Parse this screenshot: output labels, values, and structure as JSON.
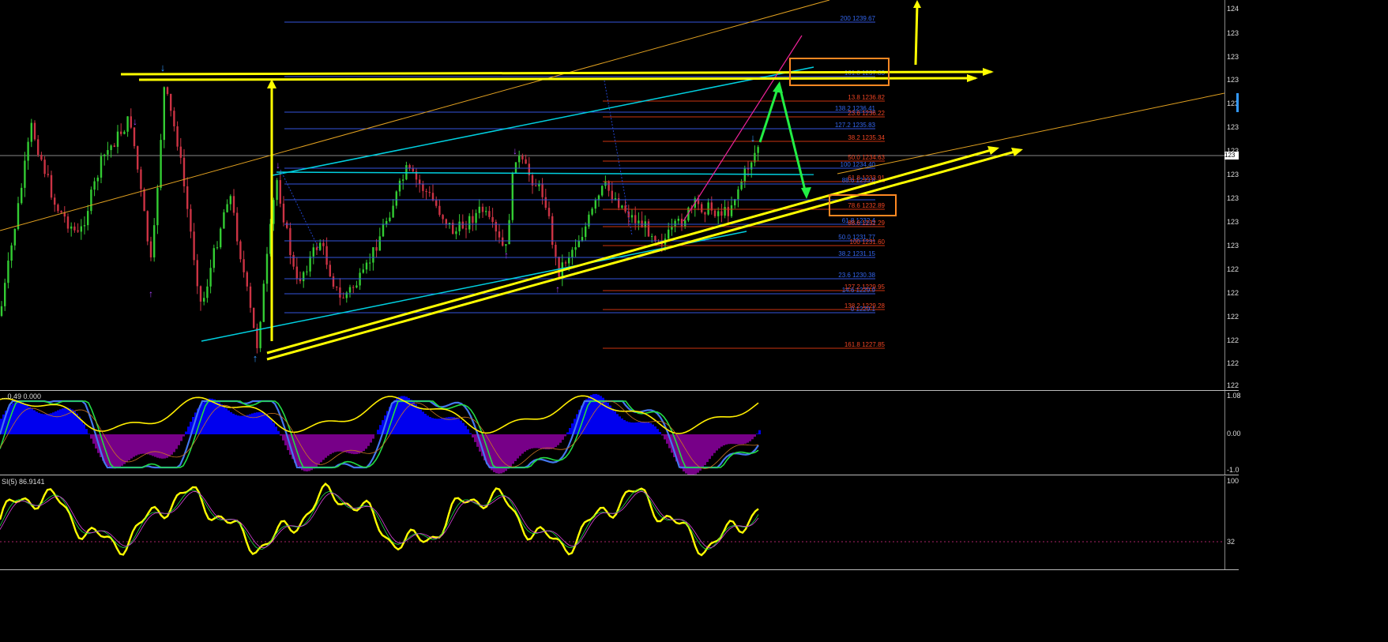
{
  "main_chart": {
    "top_right_ticks": [
      "124",
      "123",
      "123",
      "123",
      "123",
      "123",
      "123",
      "123",
      "123",
      "123",
      "123",
      "122",
      "122",
      "122",
      "122",
      "122",
      "122"
    ],
    "current_price_tag": "123",
    "fib_levels_blue": [
      {
        "label": "200 1239.67"
      },
      {
        "label": "161.8 1237.83"
      },
      {
        "label": "138.2 1236.41"
      },
      {
        "label": "127.2 1235.83"
      },
      {
        "label": "100 1234.40"
      },
      {
        "label": "88.6 1233.8"
      },
      {
        "label": "61.8 1232.4"
      },
      {
        "label": "50.0 1231.77"
      },
      {
        "label": "38.2 1231.15"
      },
      {
        "label": "23.6 1230.38"
      },
      {
        "label": "14.6 1229.9"
      },
      {
        "label": "0 1229.1"
      }
    ],
    "fib_levels_orange": [
      {
        "label": "13.8 1236.82"
      },
      {
        "label": "23.6 1236.22"
      },
      {
        "label": "38.2 1235.34"
      },
      {
        "label": "50.0 1234.63"
      },
      {
        "label": "61.8 1233.91"
      },
      {
        "label": "78.6 1232.89"
      },
      {
        "label": "88.6 1232.29"
      },
      {
        "label": "100 1231.60"
      },
      {
        "label": "127.2 1229.95"
      },
      {
        "label": "138.2 1229.28"
      },
      {
        "label": "161.8 1227.85"
      }
    ]
  },
  "oscillator1": {
    "label": "...0.49 0.000",
    "axis": [
      "1.08",
      "0.00",
      "-1.0"
    ]
  },
  "oscillator2": {
    "label": "SI(5) 86.9141",
    "axis": [
      "100",
      "32"
    ]
  },
  "colors": {
    "background": "#000000",
    "bull_candle": "#33cc33",
    "bear_candle": "#cc3333",
    "trendline_yellow": "#ffff00",
    "trendline_cyan": "#00d0e0",
    "trendline_orange": "#e0a020",
    "fib_blue": "#3355dd",
    "fib_orange": "#dd3311",
    "arrow_green": "#22ee44",
    "highlight_box": "#ff8822",
    "magenta_line": "#ee2299",
    "hist_blue": "#0000ee",
    "hist_purple": "#770088"
  }
}
